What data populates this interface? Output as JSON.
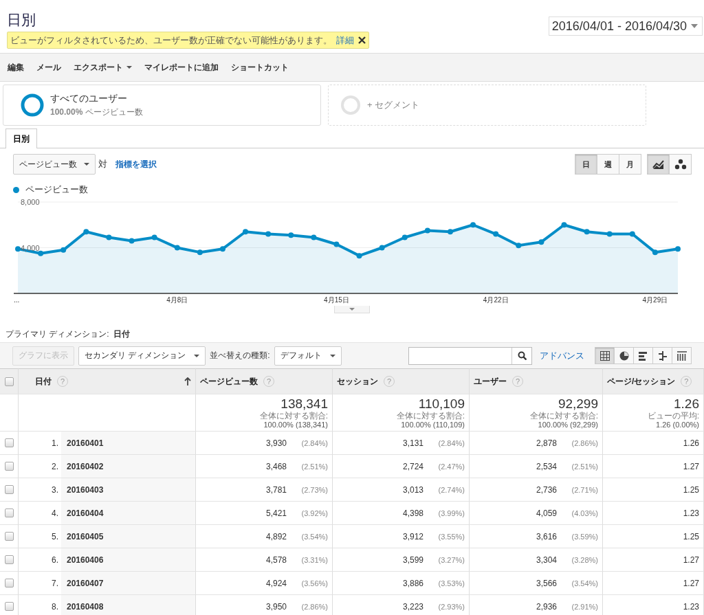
{
  "page": {
    "title": "日別",
    "date_range": "2016/04/01 - 2016/04/30"
  },
  "notice": {
    "text": "ビューがフィルタされているため、ユーザー数が正確でない可能性があります。",
    "link": "詳細"
  },
  "toolbar": [
    {
      "label": "編集",
      "dropdown": false
    },
    {
      "label": "メール",
      "dropdown": false
    },
    {
      "label": "エクスポート",
      "dropdown": true
    },
    {
      "label": "マイレポートに追加",
      "dropdown": false
    },
    {
      "label": "ショートカット",
      "dropdown": false
    }
  ],
  "segments": [
    {
      "kind": "segment",
      "name": "すべてのユーザー",
      "share": "100.00%",
      "metric": "ページビュー数"
    },
    {
      "kind": "add",
      "name": "+ セグメント"
    }
  ],
  "tabs": [
    {
      "label": "日別",
      "selected": true
    }
  ],
  "chart_controls": {
    "metric": "ページビュー数",
    "vs": "対",
    "select_metric": "指標を選択",
    "periods": [
      {
        "label": "日",
        "selected": true
      },
      {
        "label": "週",
        "selected": false
      },
      {
        "label": "月",
        "selected": false
      }
    ],
    "chart_types": [
      {
        "kind": "line",
        "selected": true
      },
      {
        "kind": "motion",
        "selected": false
      }
    ]
  },
  "chart": {
    "chart_data": {
      "type": "area",
      "categories": [
        "...",
        null,
        null,
        null,
        null,
        null,
        null,
        "4月8日",
        null,
        null,
        null,
        null,
        null,
        null,
        "4月15日",
        null,
        null,
        null,
        null,
        null,
        null,
        "4月22日",
        null,
        null,
        null,
        null,
        null,
        null,
        "4月29日",
        null
      ],
      "series": [
        {
          "name": "ページビュー数",
          "color": "#058dc7",
          "values": [
            3900,
            3500,
            3800,
            5400,
            4900,
            4600,
            4900,
            4000,
            3600,
            3900,
            5400,
            5200,
            5100,
            4900,
            4300,
            3300,
            4000,
            4900,
            5500,
            5400,
            6000,
            5200,
            4200,
            4500,
            6000,
            5400,
            5200,
            5200,
            3600,
            3900
          ]
        }
      ],
      "ylim": [
        0,
        8000
      ],
      "yticks": [
        {
          "value": 4000,
          "label": "4,000"
        },
        {
          "value": 8000,
          "label": "8,000"
        }
      ]
    }
  },
  "dimension": {
    "label": "プライマリ ディメンション:",
    "value": "日付"
  },
  "table_toolbar": {
    "plot_button": "グラフに表示",
    "plot_disabled": true,
    "secondary": "セカンダリ ディメンション",
    "sort_label": "並べ替えの種類:",
    "sort": "デフォルト",
    "advanced": "アドバンス",
    "views": [
      {
        "kind": "table",
        "selected": true
      },
      {
        "kind": "pie",
        "selected": false
      },
      {
        "kind": "bar",
        "selected": false
      },
      {
        "kind": "compare",
        "selected": false
      },
      {
        "kind": "pivot",
        "selected": false
      }
    ]
  },
  "table": {
    "select_all": {
      "checked": false
    },
    "columns": [
      {
        "label": "日付",
        "help": "?",
        "sorted": true
      },
      {
        "label": "ページビュー数",
        "help": "?",
        "sorted": false
      },
      {
        "label": "セッション",
        "help": "?",
        "sorted": false
      },
      {
        "label": "ユーザー",
        "help": "?",
        "sorted": false
      },
      {
        "label": "ページ/セッション",
        "help": "?",
        "sorted": false
      }
    ],
    "totals": [
      {
        "value": "138,341",
        "label": "全体に対する割合:",
        "detail": "100.00% (138,341)"
      },
      {
        "value": "110,109",
        "label": "全体に対する割合:",
        "detail": "100.00% (110,109)"
      },
      {
        "value": "92,299",
        "label": "全体に対する割合:",
        "detail": "100.00% (92,299)"
      },
      {
        "value": "1.26",
        "label": "ビューの平均:",
        "detail": "1.26 (0.00%)"
      }
    ],
    "rows": [
      {
        "index": "1.",
        "date": "20160401",
        "checked": false,
        "cells": [
          {
            "value": "3,930",
            "pct": "(2.84%)"
          },
          {
            "value": "3,131",
            "pct": "(2.84%)"
          },
          {
            "value": "2,878",
            "pct": "(2.86%)"
          },
          {
            "value": "1.26"
          }
        ]
      },
      {
        "index": "2.",
        "date": "20160402",
        "checked": false,
        "cells": [
          {
            "value": "3,468",
            "pct": "(2.51%)"
          },
          {
            "value": "2,724",
            "pct": "(2.47%)"
          },
          {
            "value": "2,534",
            "pct": "(2.51%)"
          },
          {
            "value": "1.27"
          }
        ]
      },
      {
        "index": "3.",
        "date": "20160403",
        "checked": false,
        "cells": [
          {
            "value": "3,781",
            "pct": "(2.73%)"
          },
          {
            "value": "3,013",
            "pct": "(2.74%)"
          },
          {
            "value": "2,736",
            "pct": "(2.71%)"
          },
          {
            "value": "1.25"
          }
        ]
      },
      {
        "index": "4.",
        "date": "20160404",
        "checked": false,
        "cells": [
          {
            "value": "5,421",
            "pct": "(3.92%)"
          },
          {
            "value": "4,398",
            "pct": "(3.99%)"
          },
          {
            "value": "4,059",
            "pct": "(4.03%)"
          },
          {
            "value": "1.23"
          }
        ]
      },
      {
        "index": "5.",
        "date": "20160405",
        "checked": false,
        "cells": [
          {
            "value": "4,892",
            "pct": "(3.54%)"
          },
          {
            "value": "3,912",
            "pct": "(3.55%)"
          },
          {
            "value": "3,616",
            "pct": "(3.59%)"
          },
          {
            "value": "1.25"
          }
        ]
      },
      {
        "index": "6.",
        "date": "20160406",
        "checked": false,
        "cells": [
          {
            "value": "4,578",
            "pct": "(3.31%)"
          },
          {
            "value": "3,599",
            "pct": "(3.27%)"
          },
          {
            "value": "3,304",
            "pct": "(3.28%)"
          },
          {
            "value": "1.27"
          }
        ]
      },
      {
        "index": "7.",
        "date": "20160407",
        "checked": false,
        "cells": [
          {
            "value": "4,924",
            "pct": "(3.56%)"
          },
          {
            "value": "3,886",
            "pct": "(3.53%)"
          },
          {
            "value": "3,566",
            "pct": "(3.54%)"
          },
          {
            "value": "1.27"
          }
        ]
      },
      {
        "index": "8.",
        "date": "20160408",
        "checked": false,
        "cells": [
          {
            "value": "3,950",
            "pct": "(2.86%)"
          },
          {
            "value": "3,223",
            "pct": "(2.93%)"
          },
          {
            "value": "2,936",
            "pct": "(2.91%)"
          },
          {
            "value": "1.23"
          }
        ]
      }
    ]
  }
}
